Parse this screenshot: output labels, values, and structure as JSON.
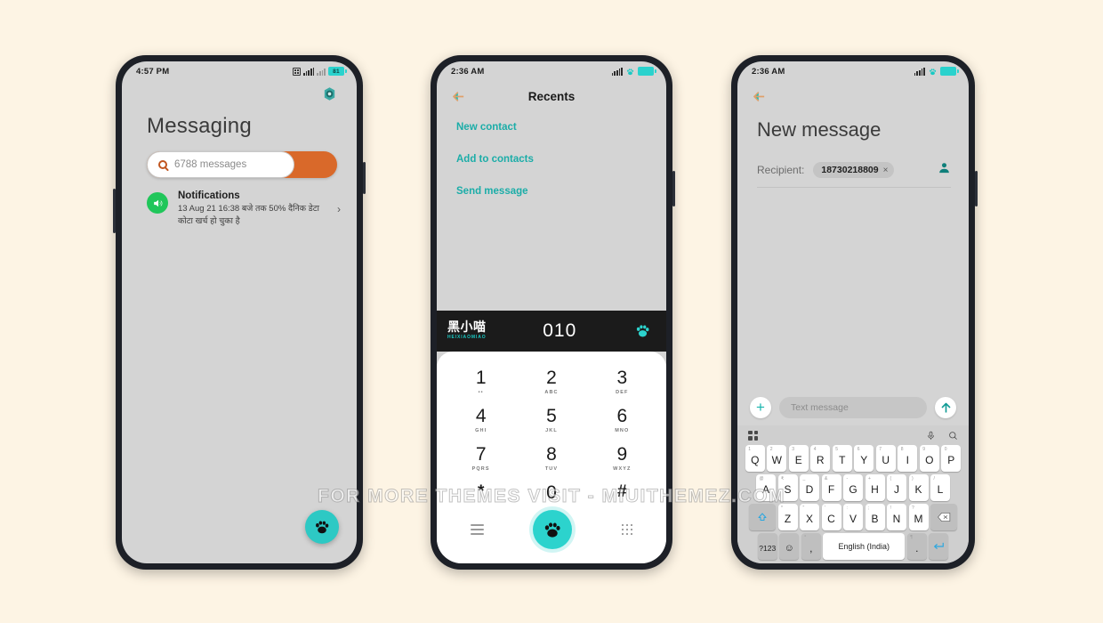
{
  "watermark": "FOR MORE THEMES VISIT - MIUITHEMEZ.COM",
  "colors": {
    "background": "#fdf4e4",
    "phone_frame": "#1d2027",
    "screen": "#d4d4d4",
    "teal": "#2dc9c4",
    "teal_dark": "#1bada8",
    "orange": "#d9692a",
    "green": "#20c65a",
    "keypad_bg": "#ffffff",
    "dial_header": "#1b1b1b"
  },
  "phone1": {
    "status": {
      "time": "4:57 PM",
      "battery": "81",
      "icons": [
        "sim-icon",
        "signal-bars-icon",
        "signal-bars-dim-icon",
        "battery-icon"
      ]
    },
    "gear_icon": "gear-icon",
    "title": "Messaging",
    "search": {
      "value": "6788 messages",
      "icon": "search-icon"
    },
    "notification": {
      "title": "Notifications",
      "text": "13 Aug 21 16:38 बजे तक 50% दैनिक डेटा कोटा खर्च हो चुका है",
      "icon": "speaker-icon",
      "chevron": "›"
    },
    "fab_icon": "paw-icon"
  },
  "phone2": {
    "status": {
      "time": "2:36 AM",
      "icons": [
        "signal-bars-icon",
        "paw-icon",
        "battery-icon"
      ]
    },
    "back_icon": "back-arrow-icon",
    "title": "Recents",
    "links": [
      "New contact",
      "Add to contacts",
      "Send message"
    ],
    "dialer": {
      "brand_cn": "黑小喵",
      "brand_en": "HEIXIAOMIAO",
      "number": "010",
      "header_icon": "paw-icon",
      "keys": [
        {
          "digit": "1",
          "sub": "••"
        },
        {
          "digit": "2",
          "sub": "ABC"
        },
        {
          "digit": "3",
          "sub": "DEF"
        },
        {
          "digit": "4",
          "sub": "GHI"
        },
        {
          "digit": "5",
          "sub": "JKL"
        },
        {
          "digit": "6",
          "sub": "MNO"
        },
        {
          "digit": "7",
          "sub": "PQRS"
        },
        {
          "digit": "8",
          "sub": "TUV"
        },
        {
          "digit": "9",
          "sub": "WXYZ"
        },
        {
          "digit": "*",
          "sub": ""
        },
        {
          "digit": "0",
          "sub": "+"
        },
        {
          "digit": "#",
          "sub": ""
        }
      ],
      "bottom": {
        "menu_icon": "hamburger-icon",
        "call_icon": "paw-call-icon",
        "keypad_icon": "dialpad-icon"
      }
    }
  },
  "phone3": {
    "status": {
      "time": "2:36 AM",
      "icons": [
        "signal-bars-icon",
        "paw-icon",
        "battery-icon"
      ]
    },
    "back_icon": "back-arrow-icon",
    "title": "New message",
    "recipient_label": "Recipient:",
    "recipient_chip": {
      "number": "18730218809",
      "remove": "×"
    },
    "contact_icon": "person-icon",
    "compose": {
      "add_label": "+",
      "placeholder": "Text message",
      "send_icon": "send-arrow-icon"
    },
    "keyboard": {
      "tools": {
        "grid_icon": "grid-icon",
        "mic_icon": "mic-icon",
        "search_icon": "search-icon"
      },
      "row1": [
        {
          "k": "Q",
          "n": "1"
        },
        {
          "k": "W",
          "n": "2"
        },
        {
          "k": "E",
          "n": "3"
        },
        {
          "k": "R",
          "n": "4"
        },
        {
          "k": "T",
          "n": "5"
        },
        {
          "k": "Y",
          "n": "6"
        },
        {
          "k": "U",
          "n": "7"
        },
        {
          "k": "I",
          "n": "8"
        },
        {
          "k": "O",
          "n": "9"
        },
        {
          "k": "P",
          "n": "0"
        }
      ],
      "row2": [
        {
          "k": "A",
          "n": "@"
        },
        {
          "k": "S",
          "n": "₹"
        },
        {
          "k": "D",
          "n": "_"
        },
        {
          "k": "F",
          "n": "&"
        },
        {
          "k": "G",
          "n": "-"
        },
        {
          "k": "H",
          "n": "+"
        },
        {
          "k": "J",
          "n": "("
        },
        {
          "k": "K",
          "n": ")"
        },
        {
          "k": "L",
          "n": "/"
        }
      ],
      "row3_shift": "shift-icon",
      "row3": [
        {
          "k": "Z",
          "n": "*"
        },
        {
          "k": "X",
          "n": "\""
        },
        {
          "k": "C",
          "n": "'"
        },
        {
          "k": "V",
          "n": ":"
        },
        {
          "k": "B",
          "n": ";"
        },
        {
          "k": "N",
          "n": "!"
        },
        {
          "k": "M",
          "n": "?"
        }
      ],
      "row3_backspace": "backspace-icon",
      "row4": {
        "symbols": "?123",
        "emoji": "☺",
        "comma": ",",
        "comma_sup": "°",
        "space": "English (India)",
        "period": ".",
        "period_sup": "¶",
        "enter": "enter-icon"
      }
    }
  }
}
